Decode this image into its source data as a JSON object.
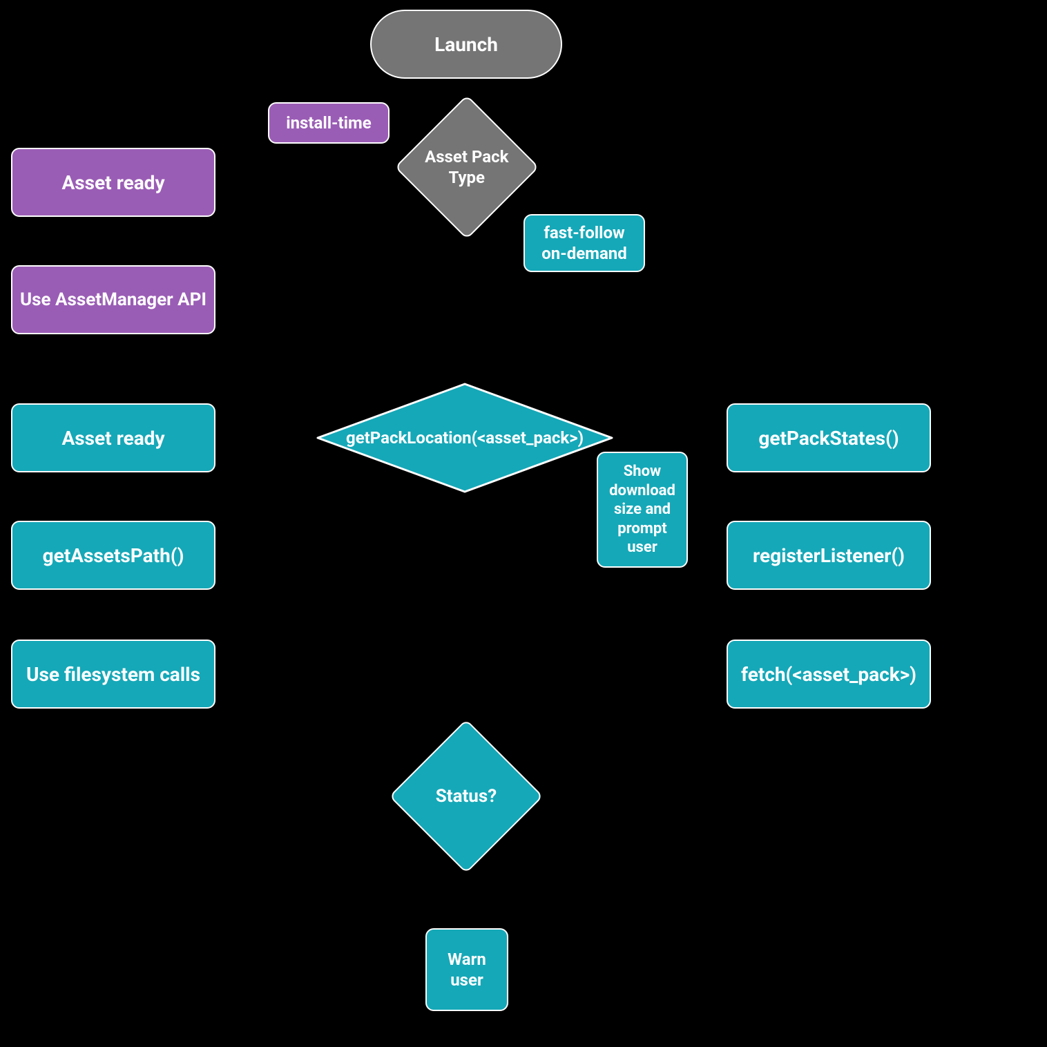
{
  "nodes": {
    "launch": "Launch",
    "asset_pack_type": "Asset Pack\nType",
    "install_time": "install-time",
    "fast_follow_on_demand": "fast-follow\non-demand",
    "asset_ready_purple": "Asset ready",
    "use_assetmanager_api": "Use AssetManager API",
    "get_pack_location": "getPackLocation(<asset_pack>)",
    "show_download_prompt": "Show\ndownload\nsize and\nprompt\nuser",
    "asset_ready_teal": "Asset ready",
    "get_pack_states": "getPackStates()",
    "get_assets_path": "getAssetsPath()",
    "register_listener": "registerListener()",
    "use_filesystem_calls": "Use filesystem calls",
    "fetch_asset_pack": "fetch(<asset_pack>)",
    "status": "Status?",
    "warn_user": "Warn\nuser"
  }
}
